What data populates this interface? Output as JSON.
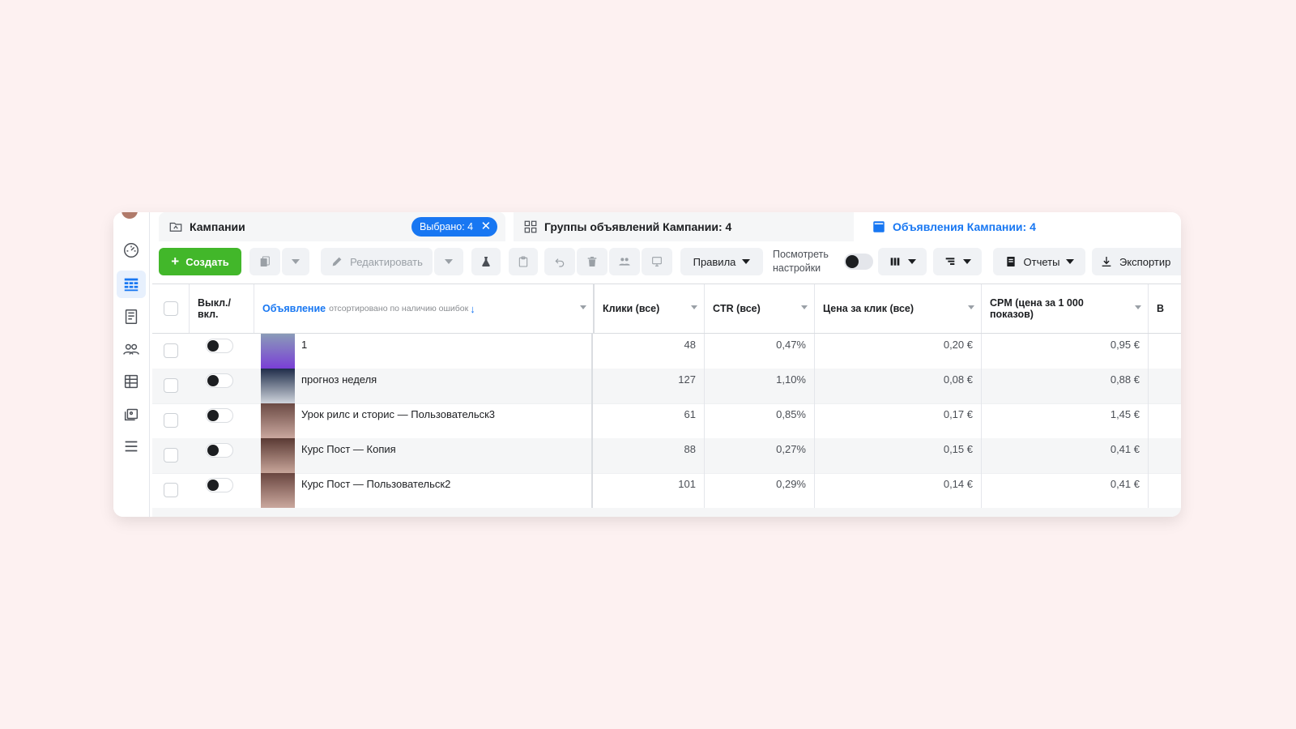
{
  "tabs": {
    "campaigns": "Кампании",
    "selected_chip": "Выбрано: 4",
    "adsets": "Группы объявлений Кампании: 4",
    "ads": "Объявления Кампании: 4"
  },
  "toolbar": {
    "create": "Создать",
    "edit": "Редактировать",
    "rules": "Правила",
    "preview_line1": "Посмотреть",
    "preview_line2": "настройки",
    "reports": "Отчеты",
    "export": "Экспортир"
  },
  "table": {
    "headers": {
      "toggle_line1": "Выкл./",
      "toggle_line2": "вкл.",
      "ad": "Объявление",
      "ad_sort_note": "отсортировано по наличию ошибок",
      "clicks": "Клики (все)",
      "ctr": "CTR (все)",
      "cpc": "Цена за клик (все)",
      "cpm_line1": "CPM (цена за 1 000",
      "cpm_line2": "показов)",
      "partial": "В"
    },
    "rows": [
      {
        "name": "1",
        "clicks": "48",
        "ctr": "0,47%",
        "cpc": "0,20 €",
        "cpm": "0,95 €"
      },
      {
        "name": "прогноз неделя",
        "clicks": "127",
        "ctr": "1,10%",
        "cpc": "0,08 €",
        "cpm": "0,88 €"
      },
      {
        "name": "Урок рилс и сторис — Пользовательск3",
        "clicks": "61",
        "ctr": "0,85%",
        "cpc": "0,17 €",
        "cpm": "1,45 €"
      },
      {
        "name": "Курс Пост — Копия",
        "clicks": "88",
        "ctr": "0,27%",
        "cpc": "0,15 €",
        "cpm": "0,41 €"
      },
      {
        "name": "Курс Пост — Пользовательск2",
        "clicks": "101",
        "ctr": "0,29%",
        "cpc": "0,14 €",
        "cpm": "0,41 €"
      }
    ]
  },
  "colors": {
    "accent": "#1877f2",
    "create_green": "#42b72a",
    "background": "#fdf1f1"
  }
}
